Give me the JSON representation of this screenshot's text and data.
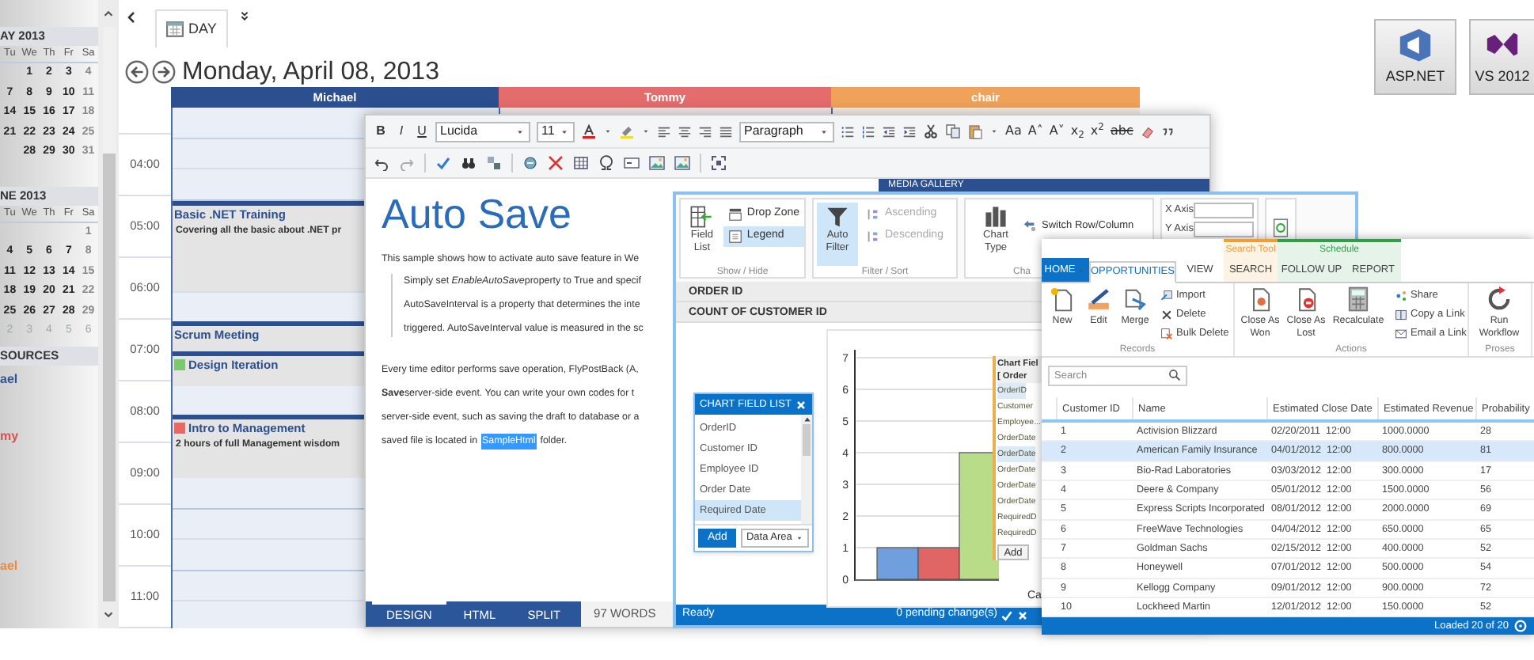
{
  "scheduler": {
    "mini_calendars": [
      {
        "title": "AY 2013",
        "day_headers": [
          "Tu",
          "We",
          "Th",
          "Fr",
          "Sa"
        ],
        "weeks": [
          {
            "days": [
              "1",
              "2",
              "3",
              "4"
            ],
            "other_month": false
          },
          {
            "days": [
              "7",
              "8",
              "9",
              "10",
              "11"
            ],
            "other_month": false
          },
          {
            "days": [
              "14",
              "15",
              "16",
              "17",
              "18"
            ],
            "other_month": false
          },
          {
            "days": [
              "21",
              "22",
              "23",
              "24",
              "25"
            ],
            "other_month": false
          },
          {
            "days": [
              "28",
              "29",
              "30",
              "31"
            ],
            "other_month": false
          }
        ]
      },
      {
        "title": "NE 2013",
        "day_headers": [
          "Tu",
          "We",
          "Th",
          "Fr",
          "Sa"
        ],
        "weeks": [
          {
            "days": [
              "1"
            ],
            "other_month": false
          },
          {
            "days": [
              "4",
              "5",
              "6",
              "7",
              "8"
            ],
            "other_month": false
          },
          {
            "days": [
              "11",
              "12",
              "13",
              "14",
              "15"
            ],
            "other_month": false
          },
          {
            "days": [
              "18",
              "19",
              "20",
              "21",
              "22"
            ],
            "other_month": false
          },
          {
            "days": [
              "25",
              "26",
              "27",
              "28",
              "29"
            ],
            "other_month": false
          },
          {
            "days": [
              "2",
              "3",
              "4",
              "5",
              "6"
            ],
            "other_month": true
          }
        ]
      }
    ],
    "resources_title": "SOURCES",
    "resource_list": [
      {
        "label": "ael",
        "color": "#2f5597"
      },
      {
        "label": "my",
        "color": "#d9534f"
      },
      {
        "label": "ael",
        "color": "#ee8a3a"
      }
    ],
    "view_tab": "DAY",
    "date": "Monday, April 08, 2013",
    "resources": [
      {
        "name": "Michael",
        "color": "#2b4f8f"
      },
      {
        "name": "Tommy",
        "color": "#e46c6c"
      },
      {
        "name": "chair",
        "color": "#f0a25a"
      }
    ],
    "hours": [
      "04:00",
      "05:00",
      "06:00",
      "07:00",
      "08:00",
      "09:00",
      "10:00",
      "11:00"
    ],
    "events": [
      {
        "title": "Basic .NET Training",
        "description": "Covering all the basic about .NET pr"
      },
      {
        "title": "Scrum Meeting"
      },
      {
        "title": "Design Iteration",
        "color": "#7cc86e"
      },
      {
        "title": "Intro to Management",
        "color": "#e86868",
        "description": "2 hours of full Management wisdom"
      }
    ]
  },
  "logos": [
    {
      "label": "ASP.NET"
    },
    {
      "label": "VS 2012"
    }
  ],
  "editor": {
    "format_buttons": [
      "B",
      "I",
      "U"
    ],
    "font": "Lucida",
    "size": "11",
    "block": "Paragraph",
    "text_buttons": [
      "Aa",
      "A˄",
      "A˅",
      "x$_{2}$",
      "x$^{2}$",
      "abc"
    ],
    "title": "Auto Save",
    "intro": "This sample shows how to activate auto save feature in We",
    "quote_first": {
      "before": "Simply set",
      "italic": "EnableAutoSave",
      "after": "property to True and specif"
    },
    "quote_lines": [
      "AutoSaveInterval is a property that determines the inte",
      "triggered. AutoSaveInterval value is measured in the sc"
    ],
    "body_lines": [
      "Every time editor performs save operation, FlyPostBack (A,",
      "**Save**server-side event. You can write your own codes for t",
      "server-side event, such as saving the draft to database or a"
    ],
    "last_line": {
      "before": "saved file is located in",
      "highlight": "SampleHtml",
      "after": "folder."
    },
    "side_panel_title": "MEDIA GALLERY",
    "mode_tabs": [
      {
        "label": "DESIGN",
        "selected": true
      },
      {
        "label": "HTML",
        "selected": false
      },
      {
        "label": "SPLIT",
        "selected": false
      }
    ],
    "word_count": "97 WORDS"
  },
  "pivot": {
    "ribbon": {
      "field_list": "Field List",
      "drop_zone": {
        "label": "Drop Zone",
        "selected": false
      },
      "legend": {
        "label": "Legend",
        "selected": true
      },
      "show_hide": "Show / Hide",
      "auto_filter": {
        "label": "Auto Filter",
        "selected": true
      },
      "ascending": {
        "label": "Ascending",
        "disabled": true
      },
      "descending": {
        "label": "Descending",
        "disabled": true
      },
      "filter_sort": "Filter / Sort",
      "chart_type": "Chart Type",
      "switch": "Switch Row/Column",
      "chart_group": "Cha",
      "x_axis": "X Axis",
      "y_axis": "Y Axis"
    },
    "rows": [
      "ORDER ID",
      "COUNT OF CUSTOMER ID"
    ],
    "field_list": {
      "title": "CHART FIELD LIST",
      "items": [
        {
          "label": "OrderID",
          "selected": false
        },
        {
          "label": "Customer ID",
          "selected": false
        },
        {
          "label": "Employee ID",
          "selected": false
        },
        {
          "label": "Order Date",
          "selected": false
        },
        {
          "label": "Required Date",
          "selected": true
        }
      ],
      "add": "Add",
      "area": "Data Area"
    },
    "chart_data": {
      "type": "bar",
      "xlabel": "Ca",
      "grid": true,
      "ylim": [
        0,
        7
      ],
      "yticks": [
        0,
        1,
        2,
        3,
        4,
        5,
        6,
        7
      ],
      "series": [
        {
          "color": "#6f9fdc",
          "values": [
            1
          ]
        },
        {
          "color": "#e06666",
          "values": [
            1
          ]
        },
        {
          "color": "#b8dc88",
          "values": [
            4
          ]
        }
      ]
    },
    "popup": {
      "title_lines": [
        "Chart Fiel",
        "[ Order"
      ],
      "items": [
        {
          "label": "OrderID",
          "selected": true
        },
        {
          "label": "Customer",
          "selected": false
        },
        {
          "label": "Employee...",
          "selected": false
        },
        {
          "label": "OrderDate",
          "selected": false
        },
        {
          "label": "OrderDate",
          "selected": true
        },
        {
          "label": "OrderDate",
          "selected": false
        },
        {
          "label": "OrderDate",
          "selected": false
        },
        {
          "label": "OrderDate",
          "selected": false
        },
        {
          "label": "RequiredD",
          "selected": false
        },
        {
          "label": "RequiredD",
          "selected": false
        }
      ],
      "add": "Add"
    },
    "status": "Ready",
    "pending": "0 pending change(s)"
  },
  "crm": {
    "context_groups": [
      {
        "label": "Search Tool",
        "color": "#f39c32"
      },
      {
        "label": "Schedule",
        "color": "#2e9e48"
      }
    ],
    "tabs": [
      {
        "label": "HOME",
        "kind": "file"
      },
      {
        "label": "OPPORTUNITIES",
        "kind": "tab",
        "selected": true
      },
      {
        "label": "VIEW",
        "kind": "tab",
        "selected": false
      },
      {
        "label": "SEARCH",
        "kind": "tab",
        "selected": false
      },
      {
        "label": "FOLLOW UP",
        "kind": "tab",
        "selected": false
      },
      {
        "label": "REPORT",
        "kind": "tab",
        "selected": false
      }
    ],
    "ribbon_groups": [
      {
        "label": "Records",
        "large": [
          "New",
          "Edit",
          "Merge"
        ],
        "small": [
          "Import",
          "Delete",
          "Bulk Delete"
        ]
      },
      {
        "label": "Actions",
        "large": [
          "Close As Won",
          "Close As Lost",
          "Recalculate"
        ],
        "small": [
          "Share",
          "Copy a Link",
          "Email a Link"
        ]
      },
      {
        "label": "Proses",
        "large": [
          "Run Workflow"
        ]
      }
    ],
    "search_placeholder": "Search",
    "columns": [
      "Customer ID",
      "Name",
      "Estimated Close Date",
      "Estimated Revenue",
      "Probability"
    ],
    "rows": [
      {
        "cells": [
          "1",
          "Activision Blizzard",
          "02/20/2011  12:00",
          "1000.0000",
          "28"
        ],
        "selected": false
      },
      {
        "cells": [
          "2",
          "American Family Insurance",
          "04/01/2012  12:00",
          "800.0000",
          "81"
        ],
        "selected": true
      },
      {
        "cells": [
          "3",
          "Bio-Rad Laboratories",
          "03/03/2012  12:00",
          "300.0000",
          "17"
        ],
        "selected": false
      },
      {
        "cells": [
          "4",
          "Deere & Company",
          "05/01/2012  12:00",
          "1500.0000",
          "56"
        ],
        "selected": false
      },
      {
        "cells": [
          "5",
          "Express Scripts Incorporated",
          "08/01/2012  12:00",
          "2000.0000",
          "69"
        ],
        "selected": false
      },
      {
        "cells": [
          "6",
          "FreeWave Technologies",
          "04/04/2012  12:00",
          "650.0000",
          "65"
        ],
        "selected": false
      },
      {
        "cells": [
          "7",
          "Goldman Sachs",
          "02/15/2012  12:00",
          "400.0000",
          "52"
        ],
        "selected": false
      },
      {
        "cells": [
          "8",
          "Honeywell",
          "07/01/2012  12:00",
          "500.0000",
          "54"
        ],
        "selected": false
      },
      {
        "cells": [
          "9",
          "Kellogg Company",
          "09/01/2012  12:00",
          "900.0000",
          "72"
        ],
        "selected": false
      },
      {
        "cells": [
          "10",
          "Lockheed Martin",
          "12/01/2012  12:00",
          "150.0000",
          "52"
        ],
        "selected": false
      }
    ],
    "footer": "Loaded 20 of 20"
  }
}
